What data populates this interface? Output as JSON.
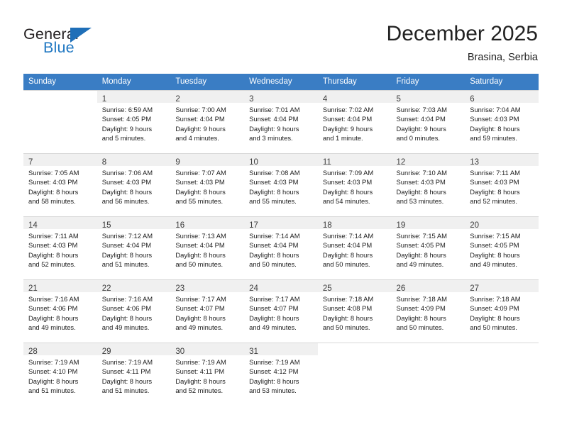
{
  "brand": {
    "word_general": "General",
    "word_blue": "Blue",
    "logo_icon": "triangle-logo-icon",
    "accent_color": "#1f6fb8"
  },
  "header": {
    "title": "December 2025",
    "subtitle": "Brasina, Serbia"
  },
  "theme": {
    "header_row_bg": "#3a7dc4",
    "header_row_text": "#ffffff",
    "daynum_bar_bg": "#f0f0f0",
    "cell_border": "#d8d8d8"
  },
  "weekdays": [
    "Sunday",
    "Monday",
    "Tuesday",
    "Wednesday",
    "Thursday",
    "Friday",
    "Saturday"
  ],
  "weeks": [
    [
      {
        "day": "",
        "lines": [
          "",
          "",
          "",
          ""
        ],
        "empty": true
      },
      {
        "day": "1",
        "lines": [
          "Sunrise: 6:59 AM",
          "Sunset: 4:05 PM",
          "Daylight: 9 hours",
          "and 5 minutes."
        ]
      },
      {
        "day": "2",
        "lines": [
          "Sunrise: 7:00 AM",
          "Sunset: 4:04 PM",
          "Daylight: 9 hours",
          "and 4 minutes."
        ]
      },
      {
        "day": "3",
        "lines": [
          "Sunrise: 7:01 AM",
          "Sunset: 4:04 PM",
          "Daylight: 9 hours",
          "and 3 minutes."
        ]
      },
      {
        "day": "4",
        "lines": [
          "Sunrise: 7:02 AM",
          "Sunset: 4:04 PM",
          "Daylight: 9 hours",
          "and 1 minute."
        ]
      },
      {
        "day": "5",
        "lines": [
          "Sunrise: 7:03 AM",
          "Sunset: 4:04 PM",
          "Daylight: 9 hours",
          "and 0 minutes."
        ]
      },
      {
        "day": "6",
        "lines": [
          "Sunrise: 7:04 AM",
          "Sunset: 4:03 PM",
          "Daylight: 8 hours",
          "and 59 minutes."
        ]
      }
    ],
    [
      {
        "day": "7",
        "lines": [
          "Sunrise: 7:05 AM",
          "Sunset: 4:03 PM",
          "Daylight: 8 hours",
          "and 58 minutes."
        ]
      },
      {
        "day": "8",
        "lines": [
          "Sunrise: 7:06 AM",
          "Sunset: 4:03 PM",
          "Daylight: 8 hours",
          "and 56 minutes."
        ]
      },
      {
        "day": "9",
        "lines": [
          "Sunrise: 7:07 AM",
          "Sunset: 4:03 PM",
          "Daylight: 8 hours",
          "and 55 minutes."
        ]
      },
      {
        "day": "10",
        "lines": [
          "Sunrise: 7:08 AM",
          "Sunset: 4:03 PM",
          "Daylight: 8 hours",
          "and 55 minutes."
        ]
      },
      {
        "day": "11",
        "lines": [
          "Sunrise: 7:09 AM",
          "Sunset: 4:03 PM",
          "Daylight: 8 hours",
          "and 54 minutes."
        ]
      },
      {
        "day": "12",
        "lines": [
          "Sunrise: 7:10 AM",
          "Sunset: 4:03 PM",
          "Daylight: 8 hours",
          "and 53 minutes."
        ]
      },
      {
        "day": "13",
        "lines": [
          "Sunrise: 7:11 AM",
          "Sunset: 4:03 PM",
          "Daylight: 8 hours",
          "and 52 minutes."
        ]
      }
    ],
    [
      {
        "day": "14",
        "lines": [
          "Sunrise: 7:11 AM",
          "Sunset: 4:03 PM",
          "Daylight: 8 hours",
          "and 52 minutes."
        ]
      },
      {
        "day": "15",
        "lines": [
          "Sunrise: 7:12 AM",
          "Sunset: 4:04 PM",
          "Daylight: 8 hours",
          "and 51 minutes."
        ]
      },
      {
        "day": "16",
        "lines": [
          "Sunrise: 7:13 AM",
          "Sunset: 4:04 PM",
          "Daylight: 8 hours",
          "and 50 minutes."
        ]
      },
      {
        "day": "17",
        "lines": [
          "Sunrise: 7:14 AM",
          "Sunset: 4:04 PM",
          "Daylight: 8 hours",
          "and 50 minutes."
        ]
      },
      {
        "day": "18",
        "lines": [
          "Sunrise: 7:14 AM",
          "Sunset: 4:04 PM",
          "Daylight: 8 hours",
          "and 50 minutes."
        ]
      },
      {
        "day": "19",
        "lines": [
          "Sunrise: 7:15 AM",
          "Sunset: 4:05 PM",
          "Daylight: 8 hours",
          "and 49 minutes."
        ]
      },
      {
        "day": "20",
        "lines": [
          "Sunrise: 7:15 AM",
          "Sunset: 4:05 PM",
          "Daylight: 8 hours",
          "and 49 minutes."
        ]
      }
    ],
    [
      {
        "day": "21",
        "lines": [
          "Sunrise: 7:16 AM",
          "Sunset: 4:06 PM",
          "Daylight: 8 hours",
          "and 49 minutes."
        ]
      },
      {
        "day": "22",
        "lines": [
          "Sunrise: 7:16 AM",
          "Sunset: 4:06 PM",
          "Daylight: 8 hours",
          "and 49 minutes."
        ]
      },
      {
        "day": "23",
        "lines": [
          "Sunrise: 7:17 AM",
          "Sunset: 4:07 PM",
          "Daylight: 8 hours",
          "and 49 minutes."
        ]
      },
      {
        "day": "24",
        "lines": [
          "Sunrise: 7:17 AM",
          "Sunset: 4:07 PM",
          "Daylight: 8 hours",
          "and 49 minutes."
        ]
      },
      {
        "day": "25",
        "lines": [
          "Sunrise: 7:18 AM",
          "Sunset: 4:08 PM",
          "Daylight: 8 hours",
          "and 50 minutes."
        ]
      },
      {
        "day": "26",
        "lines": [
          "Sunrise: 7:18 AM",
          "Sunset: 4:09 PM",
          "Daylight: 8 hours",
          "and 50 minutes."
        ]
      },
      {
        "day": "27",
        "lines": [
          "Sunrise: 7:18 AM",
          "Sunset: 4:09 PM",
          "Daylight: 8 hours",
          "and 50 minutes."
        ]
      }
    ],
    [
      {
        "day": "28",
        "lines": [
          "Sunrise: 7:19 AM",
          "Sunset: 4:10 PM",
          "Daylight: 8 hours",
          "and 51 minutes."
        ]
      },
      {
        "day": "29",
        "lines": [
          "Sunrise: 7:19 AM",
          "Sunset: 4:11 PM",
          "Daylight: 8 hours",
          "and 51 minutes."
        ]
      },
      {
        "day": "30",
        "lines": [
          "Sunrise: 7:19 AM",
          "Sunset: 4:11 PM",
          "Daylight: 8 hours",
          "and 52 minutes."
        ]
      },
      {
        "day": "31",
        "lines": [
          "Sunrise: 7:19 AM",
          "Sunset: 4:12 PM",
          "Daylight: 8 hours",
          "and 53 minutes."
        ]
      },
      {
        "day": "",
        "lines": [
          "",
          "",
          "",
          ""
        ],
        "empty": true
      },
      {
        "day": "",
        "lines": [
          "",
          "",
          "",
          ""
        ],
        "empty": true
      },
      {
        "day": "",
        "lines": [
          "",
          "",
          "",
          ""
        ],
        "empty": true
      }
    ]
  ]
}
